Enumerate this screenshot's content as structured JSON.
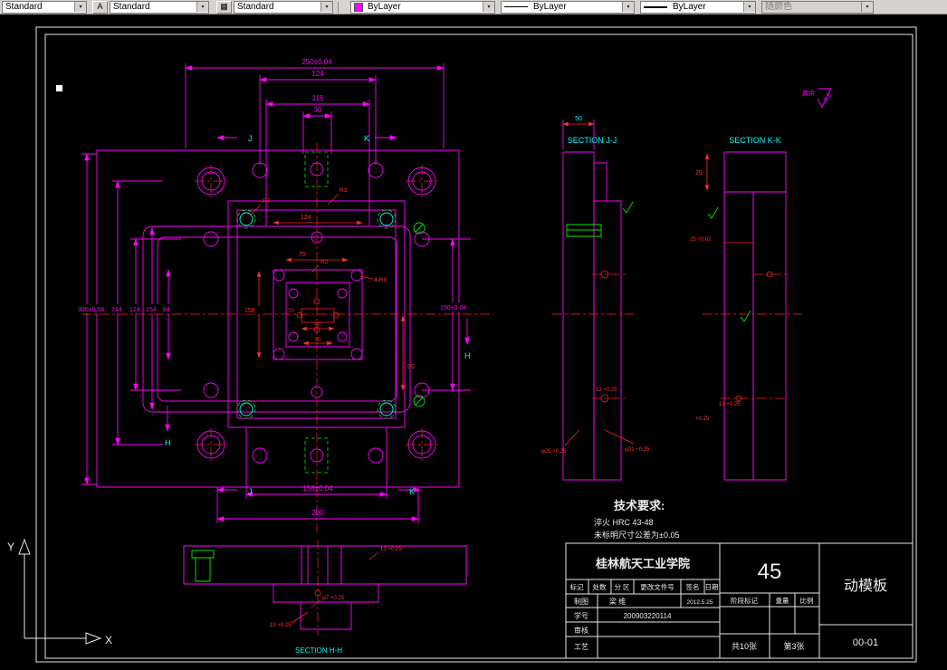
{
  "toolbar": {
    "dim_style": {
      "value": "Standard"
    },
    "text_style": {
      "value": "Standard"
    },
    "table_style": {
      "value": "Standard"
    },
    "color": {
      "value": "ByLayer",
      "swatch": "#ff00ff"
    },
    "linetype": {
      "value": "ByLayer"
    },
    "lineweight": {
      "value": "ByLayer"
    },
    "plot_style": {
      "value": "随颜色"
    },
    "chevron": "▾",
    "text_style_icon": "A",
    "table_style_icon": "▦"
  },
  "ucs": {
    "x_label": "X",
    "y_label": "Y"
  },
  "drawing": {
    "surface_note": {
      "prefix": "其余",
      "roughness": "3.2"
    },
    "sections": {
      "jj": "SECTION J-J",
      "kk": "SECTION K-K",
      "hh": "SECTION H-H"
    },
    "tech": {
      "title": "技术要求:",
      "line1": "淬火 HRC 43-48",
      "line2": "未标明尺寸公差为±0.05"
    },
    "dims": {
      "top_overall": "250±0.04",
      "top_124": "124",
      "top_116": "116",
      "top_30": "30",
      "cut_j": "J",
      "cut_k": "K",
      "cut_h": "H",
      "left_300": "300±0.04",
      "left_244": "244",
      "left_124": "124",
      "left_154": "154",
      "left_84": "84",
      "right_150": "150±0.04",
      "bottom_158": "158±0.04",
      "bottom_200": "200",
      "in_124": "124",
      "in_70a": "70",
      "in_70b": "70",
      "in_158": "158",
      "in_40": "40",
      "in_30": "30",
      "in_90": "90",
      "r7": "R7",
      "r3": "R3",
      "r2": "R2",
      "r8": "4-R8",
      "jj_50": "50",
      "jj_13": "13 +0.25",
      "jj_phi25": "φ25 +0.25",
      "jj_phi31": "φ31 +0.25",
      "kk_25a": "25",
      "kk_25b": "25 +0.02",
      "kk_13": "13 +0.25",
      "kk_tol": "+0.25",
      "hh_13a": "13 +0.25",
      "hh_phi7": "φ7 +0.25",
      "hh_13b": "13 +0.25"
    }
  },
  "title_block": {
    "school": "桂林航天工业学院",
    "material": "45",
    "part_name": "动模板",
    "drawing_no": "00-01",
    "sheets_total": "共10张",
    "sheet_no": "第3张",
    "row_headers": [
      "标记",
      "处数",
      "分 区",
      "更改文件号",
      "签名",
      "日期"
    ],
    "stage_headers": [
      "阶段标记",
      "重量",
      "比例"
    ],
    "drafter_label": "制图",
    "drafter_name": "梁 维",
    "date": "2012.5.25",
    "student_label": "学号",
    "student_no": "200903220114",
    "checker_label": "审核",
    "process_label": "工艺"
  }
}
